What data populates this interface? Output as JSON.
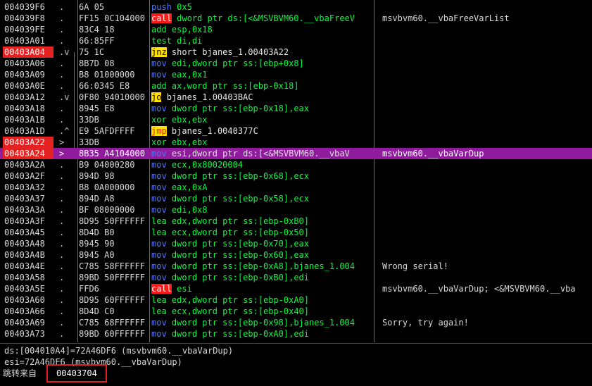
{
  "rows": [
    {
      "addr": "004039F6",
      "mark": ".",
      "bytes": "6A 05",
      "op": "push",
      "op_style": "blue",
      "args": "0x5",
      "comment": ""
    },
    {
      "addr": "004039F8",
      "mark": ".",
      "bytes": "FF15 0C104000",
      "op": "call",
      "op_style": "call",
      "args": "dword ptr ds:[<&MSVBVM60.__vbaFreeV",
      "comment": "msvbvm60.__vbaFreeVarList"
    },
    {
      "addr": "004039FE",
      "mark": ".",
      "bytes": "83C4 18",
      "op": "add",
      "op_style": "green",
      "args": "esp,0x18",
      "comment": ""
    },
    {
      "addr": "00403A01",
      "mark": ".",
      "bytes": "66:85FF",
      "op": "test",
      "op_style": "green",
      "args": "di,di",
      "comment": ""
    },
    {
      "addr": "00403A04",
      "mark": ".v",
      "bytes": "75 1C",
      "op": "jnz",
      "op_style": "yellow",
      "args": "short bjanes_1.00403A22",
      "args_style": "white",
      "comment": "",
      "addr_red": true
    },
    {
      "addr": "00403A06",
      "mark": ".",
      "bytes": "8B7D 08",
      "op": "mov",
      "op_style": "blue",
      "args": "edi,dword ptr ss:[ebp+0x8]",
      "comment": ""
    },
    {
      "addr": "00403A09",
      "mark": ".",
      "bytes": "B8 01000000",
      "op": "mov",
      "op_style": "blue",
      "args": "eax,0x1",
      "comment": ""
    },
    {
      "addr": "00403A0E",
      "mark": ".",
      "bytes": "66:0345 E8",
      "op": "add",
      "op_style": "green",
      "args": "ax,word ptr ss:[ebp-0x18]",
      "comment": ""
    },
    {
      "addr": "00403A12",
      "mark": ".v",
      "bytes": "0F80 94010000",
      "op": "jo",
      "op_style": "yellow",
      "args": "bjanes_1.00403BAC",
      "args_style": "white",
      "comment": ""
    },
    {
      "addr": "00403A18",
      "mark": ".",
      "bytes": "8945 E8",
      "op": "mov",
      "op_style": "blue",
      "args": "dword ptr ss:[ebp-0x18],eax",
      "comment": ""
    },
    {
      "addr": "00403A1B",
      "mark": ".",
      "bytes": "33DB",
      "op": "xor",
      "op_style": "green",
      "args": "ebx,ebx",
      "comment": ""
    },
    {
      "addr": "00403A1D",
      "mark": ".^",
      "bytes": "E9 5AFDFFFF",
      "op": "jmp",
      "op_style": "jmp",
      "args": "bjanes_1.0040377C",
      "args_style": "white",
      "comment": ""
    },
    {
      "addr": "00403A22",
      "mark": ">",
      "bytes": "33DB",
      "op": "xor",
      "op_style": "green",
      "args": "ebx,ebx",
      "comment": "",
      "addr_red": true
    },
    {
      "addr": "00403A24",
      "mark": ">",
      "bytes": "8B35 A4104000",
      "op": "mov",
      "op_style": "blue",
      "args": "esi,dword ptr ds:[<&MSVBVM60.__vbaV",
      "comment": "msvbvm60.__vbaVarDup",
      "addr_red": true,
      "selected": true
    },
    {
      "addr": "00403A2A",
      "mark": ".",
      "bytes": "B9 04000280",
      "op": "mov",
      "op_style": "blue",
      "args": "ecx,0x80020004",
      "comment": ""
    },
    {
      "addr": "00403A2F",
      "mark": ".",
      "bytes": "894D 98",
      "op": "mov",
      "op_style": "blue",
      "args": "dword ptr ss:[ebp-0x68],ecx",
      "comment": ""
    },
    {
      "addr": "00403A32",
      "mark": ".",
      "bytes": "B8 0A000000",
      "op": "mov",
      "op_style": "blue",
      "args": "eax,0xA",
      "comment": ""
    },
    {
      "addr": "00403A37",
      "mark": ".",
      "bytes": "894D A8",
      "op": "mov",
      "op_style": "blue",
      "args": "dword ptr ss:[ebp-0x58],ecx",
      "comment": ""
    },
    {
      "addr": "00403A3A",
      "mark": ".",
      "bytes": "BF 08000000",
      "op": "mov",
      "op_style": "blue",
      "args": "edi,0x8",
      "comment": ""
    },
    {
      "addr": "00403A3F",
      "mark": ".",
      "bytes": "8D95 50FFFFFF",
      "op": "lea",
      "op_style": "green",
      "args": "edx,dword ptr ss:[ebp-0xB0]",
      "comment": ""
    },
    {
      "addr": "00403A45",
      "mark": ".",
      "bytes": "8D4D B0",
      "op": "lea",
      "op_style": "green",
      "args": "ecx,dword ptr ss:[ebp-0x50]",
      "comment": ""
    },
    {
      "addr": "00403A48",
      "mark": ".",
      "bytes": "8945 90",
      "op": "mov",
      "op_style": "blue",
      "args": "dword ptr ss:[ebp-0x70],eax",
      "comment": ""
    },
    {
      "addr": "00403A4B",
      "mark": ".",
      "bytes": "8945 A0",
      "op": "mov",
      "op_style": "blue",
      "args": "dword ptr ss:[ebp-0x60],eax",
      "comment": ""
    },
    {
      "addr": "00403A4E",
      "mark": ".",
      "bytes": "C785 58FFFFFF",
      "op": "mov",
      "op_style": "blue",
      "args": "dword ptr ss:[ebp-0xA8],bjanes_1.004",
      "comment": "Wrong serial!"
    },
    {
      "addr": "00403A58",
      "mark": ".",
      "bytes": "89BD 50FFFFFF",
      "op": "mov",
      "op_style": "blue",
      "args": "dword ptr ss:[ebp-0xB0],edi",
      "comment": ""
    },
    {
      "addr": "00403A5E",
      "mark": ".",
      "bytes": "FFD6",
      "op": "call",
      "op_style": "call",
      "args": "esi",
      "comment": "msvbvm60.__vbaVarDup; <&MSVBVM60.__vba"
    },
    {
      "addr": "00403A60",
      "mark": ".",
      "bytes": "8D95 60FFFFFF",
      "op": "lea",
      "op_style": "green",
      "args": "edx,dword ptr ss:[ebp-0xA0]",
      "comment": ""
    },
    {
      "addr": "00403A66",
      "mark": ".",
      "bytes": "8D4D C0",
      "op": "lea",
      "op_style": "green",
      "args": "ecx,dword ptr ss:[ebp-0x40]",
      "comment": ""
    },
    {
      "addr": "00403A69",
      "mark": ".",
      "bytes": "C785 68FFFFFF",
      "op": "mov",
      "op_style": "blue",
      "args": "dword ptr ss:[ebp-0x98],bjanes_1.004",
      "comment": "Sorry, try again!"
    },
    {
      "addr": "00403A73",
      "mark": ".",
      "bytes": "89BD 60FFFFFF",
      "op": "mov",
      "op_style": "blue",
      "args": "dword ptr ss:[ebp-0xA0],edi",
      "comment": ""
    }
  ],
  "info": {
    "line1": "ds:[004010A4]=72A46DF6 (msvbvm60.__vbaVarDup)",
    "line2": "esi=72A46DF6 (msvbvm60.__vbaVarDup)",
    "jump_label": "跳转来自",
    "jump_addr": "00403704"
  }
}
